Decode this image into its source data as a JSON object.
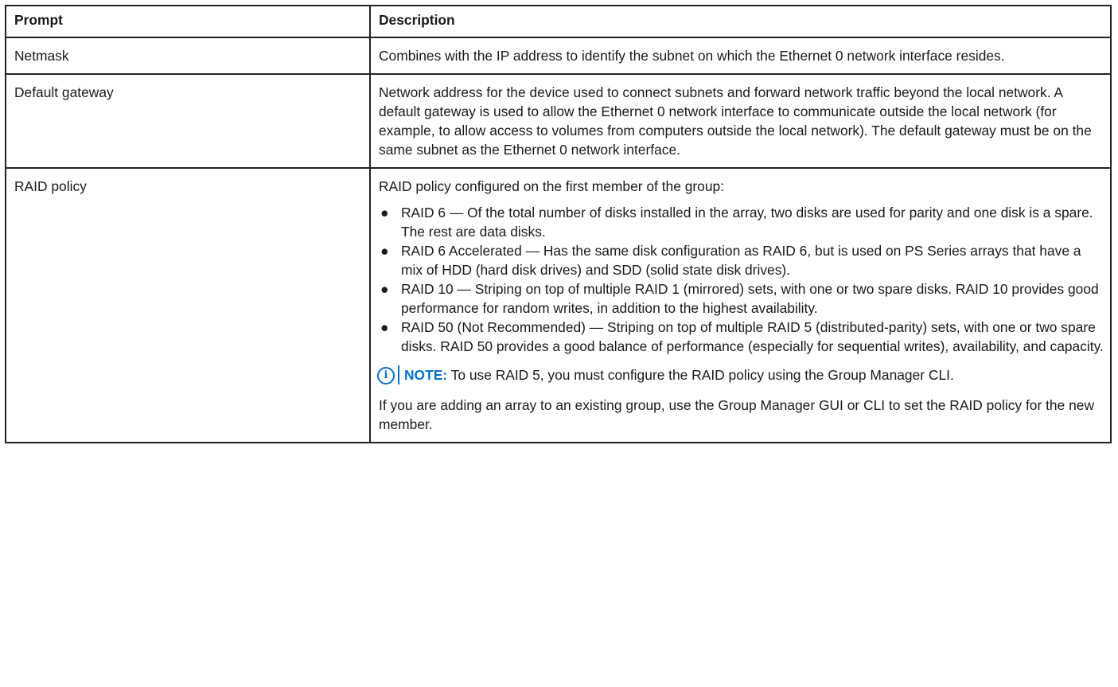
{
  "table": {
    "headers": {
      "prompt": "Prompt",
      "description": "Description"
    },
    "rows": [
      {
        "prompt": "Netmask",
        "description": "Combines with the IP address to identify the subnet on which the Ethernet 0 network interface resides."
      },
      {
        "prompt": "Default gateway",
        "description": "Network address for the device used to connect subnets and forward network traffic beyond the local network. A default gateway is used to allow the Ethernet 0 network interface to communicate outside the local network (for example, to allow access to volumes from computers outside the local network). The default gateway must be on the same subnet as the Ethernet 0 network interface."
      },
      {
        "prompt": "RAID policy",
        "intro": "RAID policy configured on the first member of the group:",
        "bullet_glyph": "●",
        "items": [
          "RAID 6 — Of the total number of disks installed in the array, two disks are used for parity and one disk is a spare. The rest are data disks.",
          "RAID 6 Accelerated — Has the same disk configuration as RAID 6, but is used on PS Series arrays that have a mix of HDD (hard disk drives) and SDD (solid state disk drives).",
          "RAID 10 — Striping on top of multiple RAID 1 (mirrored) sets, with one or two spare disks. RAID 10 provides good performance for random writes, in addition to the highest availability.",
          "RAID 50 (Not Recommended) — Striping on top of multiple RAID 5 (distributed-parity) sets, with one or two spare disks. RAID 50 provides a good balance of performance (especially for sequential writes), availability, and capacity."
        ],
        "note": {
          "icon": "info-icon",
          "label": "NOTE:",
          "text": " To use RAID 5, you must configure the RAID policy using the Group Manager CLI."
        },
        "closing": "If you are adding an array to an existing group, use the Group Manager GUI or CLI to set the RAID policy for the new member."
      }
    ]
  },
  "colors": {
    "accent": "#0672cb",
    "border": "#222222",
    "text": "#1a1a1a"
  }
}
